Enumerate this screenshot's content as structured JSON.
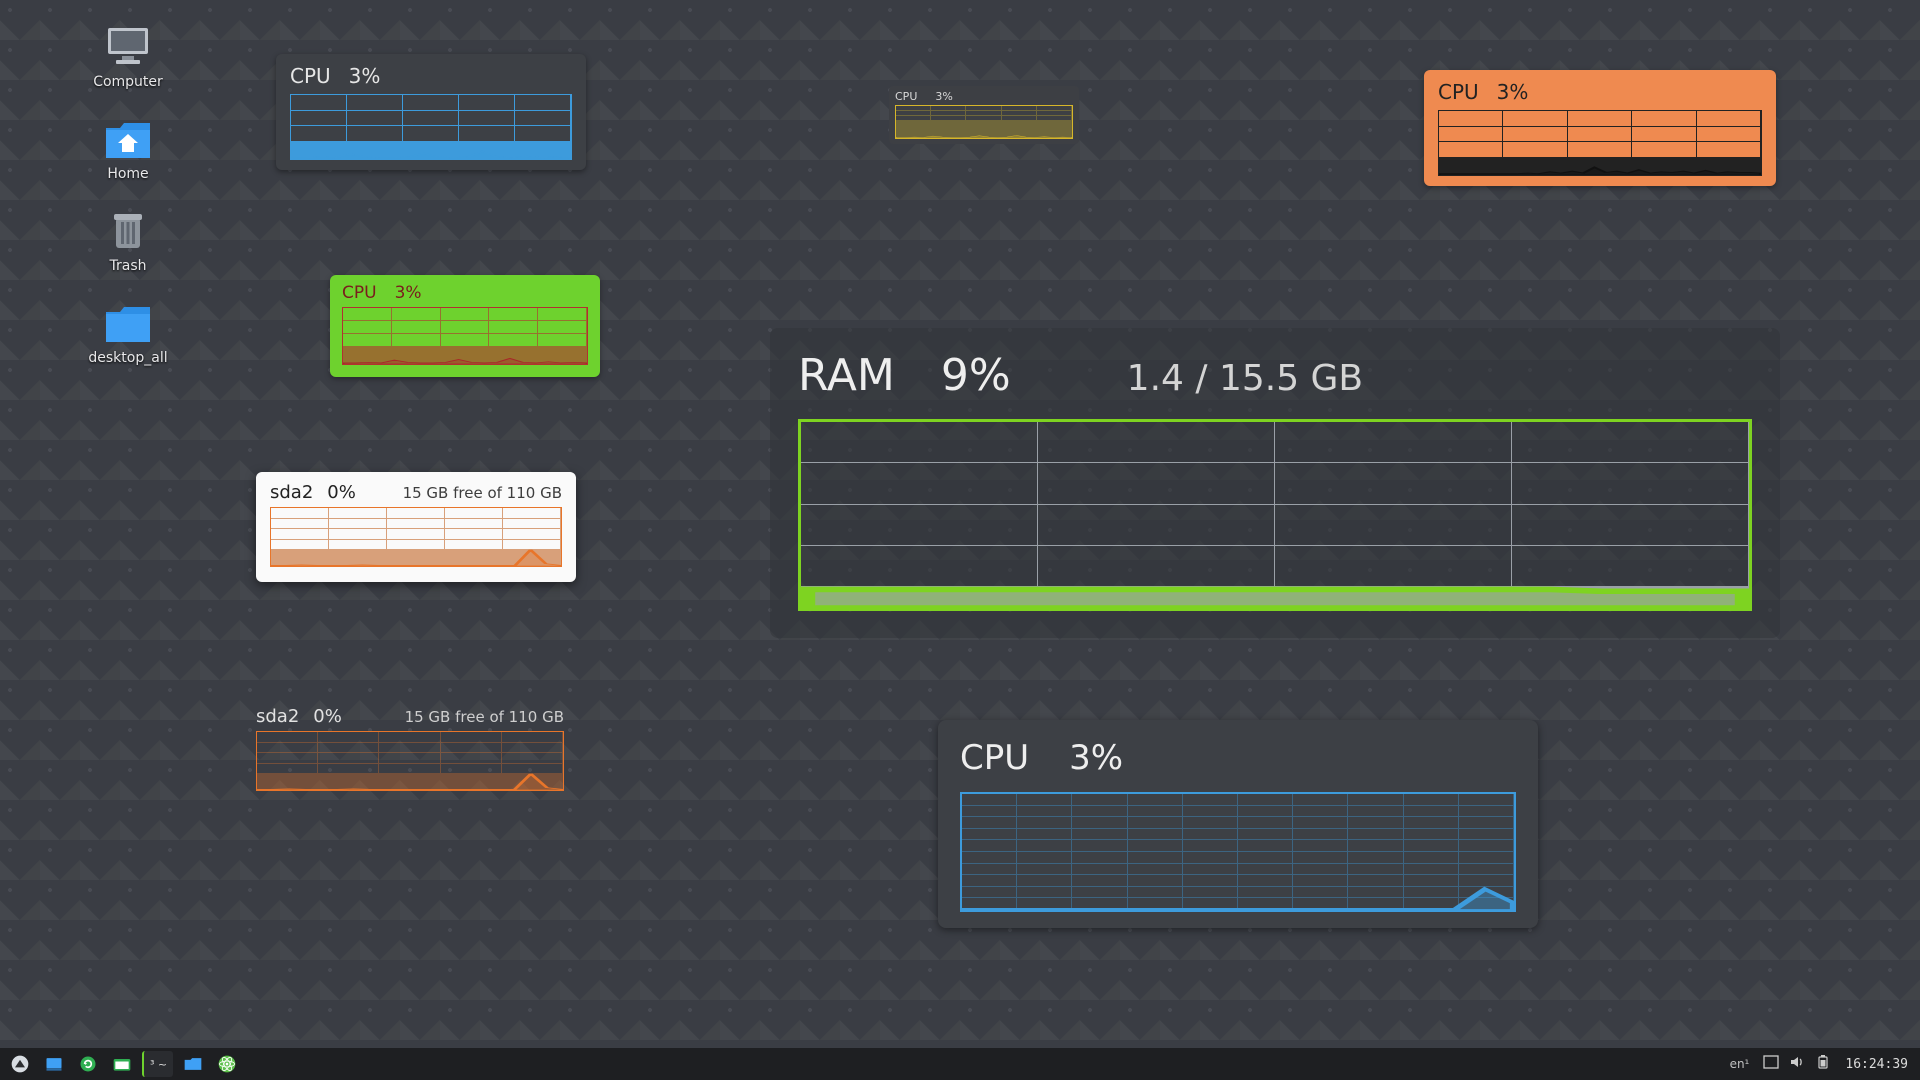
{
  "desktop_icons": [
    {
      "key": "computer",
      "label": "Computer"
    },
    {
      "key": "home",
      "label": "Home"
    },
    {
      "key": "trash",
      "label": "Trash"
    },
    {
      "key": "desktop_all",
      "label": "desktop_all"
    }
  ],
  "widgets": {
    "cpu_blue_small": {
      "label": "CPU",
      "value": "3%"
    },
    "cpu_yellow_tiny": {
      "label": "CPU",
      "value": "3%"
    },
    "cpu_orange": {
      "label": "CPU",
      "value": "3%"
    },
    "cpu_green": {
      "label": "CPU",
      "value": "3%"
    },
    "disk_white": {
      "label": "sda2",
      "value": "0%",
      "free_text": "15 GB free of 110 GB"
    },
    "disk_trans": {
      "label": "sda2",
      "value": "0%",
      "free_text": "15 GB free of 110 GB"
    },
    "ram_big": {
      "label": "RAM",
      "value": "9%",
      "secondary": "1.4 / 15.5 GB"
    },
    "cpu_blue_big": {
      "label": "CPU",
      "value": "3%"
    }
  },
  "chart_data": [
    {
      "id": "cpu_blue_small",
      "type": "area",
      "ylim": [
        0,
        100
      ],
      "xlabel": "",
      "ylabel": "",
      "title": "CPU 3%",
      "values": [
        2,
        2,
        3,
        2,
        8,
        3,
        2,
        2,
        3,
        9,
        3,
        2,
        3,
        12,
        3,
        2,
        4,
        2,
        3,
        2
      ]
    },
    {
      "id": "cpu_yellow_tiny",
      "type": "area",
      "ylim": [
        0,
        100
      ],
      "xlabel": "",
      "ylabel": "",
      "title": "CPU 3%",
      "values": [
        2,
        2,
        3,
        2,
        6,
        3,
        2,
        2,
        3,
        7,
        3,
        2,
        3,
        8,
        3,
        2,
        4,
        2,
        3,
        2
      ]
    },
    {
      "id": "cpu_orange",
      "type": "area",
      "ylim": [
        0,
        100
      ],
      "xlabel": "",
      "ylabel": "",
      "title": "CPU 3%",
      "values": [
        2,
        2,
        2,
        2,
        2,
        2,
        2,
        2,
        3,
        2,
        5,
        3,
        6,
        3,
        12,
        4,
        6,
        3,
        8,
        3,
        5,
        4,
        6,
        3,
        7,
        3,
        5,
        4,
        4,
        3
      ]
    },
    {
      "id": "cpu_green",
      "type": "area",
      "ylim": [
        0,
        100
      ],
      "xlabel": "",
      "ylabel": "",
      "title": "CPU 3%",
      "values": [
        2,
        2,
        3,
        2,
        7,
        3,
        2,
        2,
        3,
        8,
        3,
        2,
        3,
        10,
        3,
        2,
        4,
        2,
        3,
        2
      ]
    },
    {
      "id": "disk_white",
      "type": "area",
      "ylim": [
        0,
        100
      ],
      "xlabel": "",
      "ylabel": "",
      "title": "sda2 0%  15 GB free of 110 GB",
      "values": [
        1,
        1,
        2,
        1,
        1,
        1,
        2,
        1,
        1,
        1,
        1,
        1,
        1,
        1,
        1,
        1,
        1,
        28,
        4,
        1
      ]
    },
    {
      "id": "disk_trans",
      "type": "area",
      "ylim": [
        0,
        100
      ],
      "xlabel": "",
      "ylabel": "",
      "title": "sda2 0%  15 GB free of 110 GB",
      "values": [
        1,
        1,
        2,
        1,
        1,
        1,
        2,
        1,
        1,
        1,
        1,
        1,
        1,
        1,
        1,
        1,
        1,
        28,
        4,
        1
      ]
    },
    {
      "id": "ram_big",
      "type": "area",
      "ylim": [
        0,
        100
      ],
      "xlabel": "",
      "ylabel": "",
      "title": "RAM 9%  1.4 / 15.5 GB",
      "values": [
        10,
        10,
        10,
        10,
        10,
        10,
        10,
        10,
        10,
        10,
        10,
        10,
        10,
        10,
        10,
        10,
        9,
        9,
        9,
        9
      ]
    },
    {
      "id": "cpu_blue_big",
      "type": "area",
      "ylim": [
        0,
        100
      ],
      "xlabel": "",
      "ylabel": "",
      "title": "CPU 3%",
      "values": [
        1,
        1,
        1,
        1,
        1,
        1,
        1,
        1,
        1,
        1,
        1,
        1,
        1,
        1,
        1,
        1,
        1,
        1,
        18,
        6
      ]
    }
  ],
  "taskbar": {
    "lang": "en¹",
    "clock": "16:24:39",
    "group_label": "³ ~"
  }
}
